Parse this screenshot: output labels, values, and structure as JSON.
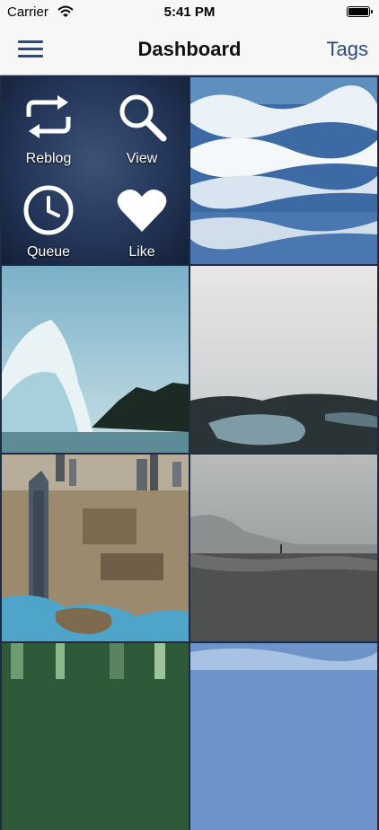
{
  "status_bar": {
    "carrier": "Carrier",
    "time": "5:41 PM"
  },
  "nav": {
    "title": "Dashboard",
    "tags_label": "Tags",
    "menu_icon": "hamburger-menu-icon"
  },
  "actions": [
    {
      "label": "Reblog",
      "icon": "reblog-icon"
    },
    {
      "label": "View",
      "icon": "magnifier-icon"
    },
    {
      "label": "Queue",
      "icon": "clock-icon"
    },
    {
      "label": "Like",
      "icon": "heart-icon"
    }
  ],
  "photos": [
    {
      "subject": "ocean waves"
    },
    {
      "subject": "crashing wave spray"
    },
    {
      "subject": "foggy coastal lake"
    },
    {
      "subject": "city skyline aerial"
    },
    {
      "subject": "misty beach"
    },
    {
      "subject": "forest"
    },
    {
      "subject": "blue sky"
    }
  ],
  "colors": {
    "accent": "#2a4a86",
    "nav_background": "#f7f7f7",
    "grid_background": "#1d2b44"
  }
}
